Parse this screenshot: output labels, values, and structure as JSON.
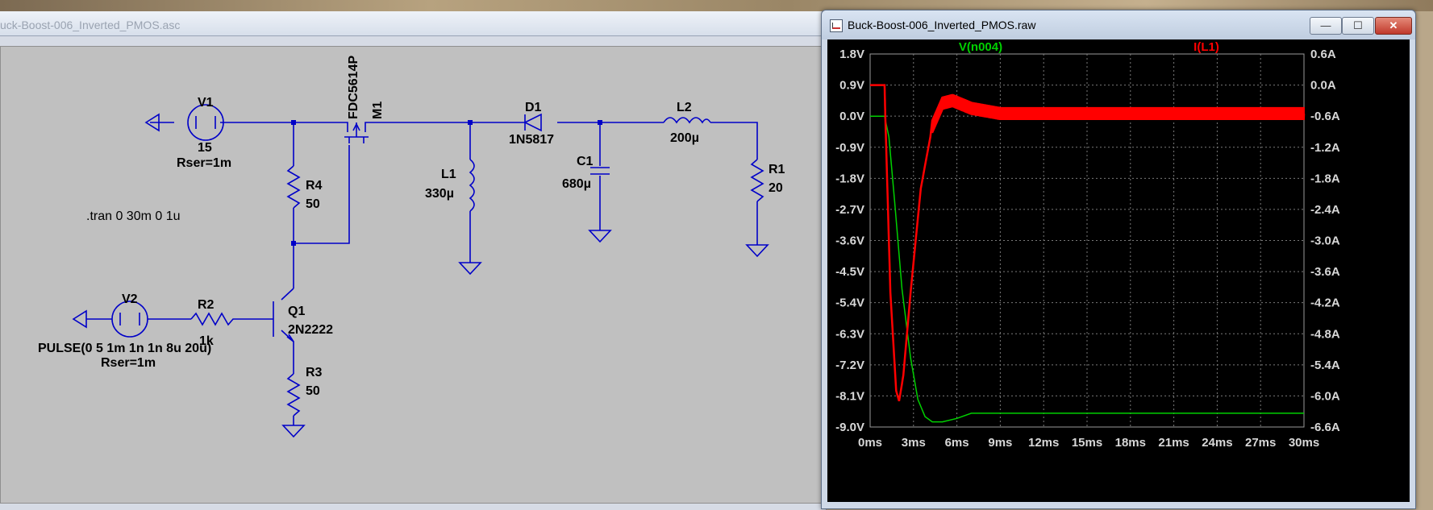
{
  "schematic_window": {
    "title": "uck-Boost-006_Inverted_PMOS.asc"
  },
  "schematic": {
    "directive": ".tran 0 30m 0 1u",
    "V1": {
      "name": "V1",
      "value": "15",
      "rser": "Rser=1m"
    },
    "V2": {
      "name": "V2",
      "value": "PULSE(0 5 1m 1n 1n 8u 20u)",
      "rser": "Rser=1m"
    },
    "R1": {
      "name": "R1",
      "value": "20"
    },
    "R2": {
      "name": "R2",
      "value": "1k"
    },
    "R3": {
      "name": "R3",
      "value": "50"
    },
    "R4": {
      "name": "R4",
      "value": "50"
    },
    "L1": {
      "name": "L1",
      "value": "330µ"
    },
    "L2": {
      "name": "L2",
      "value": "200µ"
    },
    "C1": {
      "name": "C1",
      "value": "680µ"
    },
    "D1": {
      "name": "D1",
      "value": "1N5817"
    },
    "M1": {
      "name": "M1",
      "value": "FDC5614P"
    },
    "Q1": {
      "name": "Q1",
      "value": "2N2222"
    }
  },
  "waveform_window": {
    "title": "Buck-Boost-006_Inverted_PMOS.raw",
    "buttons": {
      "minimize": "—",
      "maximize": "☐",
      "close": "✕"
    }
  },
  "chart_data": {
    "type": "line",
    "x_ticks": [
      "0ms",
      "3ms",
      "6ms",
      "9ms",
      "12ms",
      "15ms",
      "18ms",
      "21ms",
      "24ms",
      "27ms",
      "30ms"
    ],
    "xlim": [
      0,
      30
    ],
    "left_axis": {
      "ticks": [
        "1.8V",
        "0.9V",
        "0.0V",
        "-0.9V",
        "-1.8V",
        "-2.7V",
        "-3.6V",
        "-4.5V",
        "-5.4V",
        "-6.3V",
        "-7.2V",
        "-8.1V",
        "-9.0V"
      ],
      "ylim": [
        -9.0,
        1.8
      ]
    },
    "right_axis": {
      "ticks": [
        "0.6A",
        "0.0A",
        "-0.6A",
        "-1.2A",
        "-1.8A",
        "-2.4A",
        "-3.0A",
        "-3.6A",
        "-4.2A",
        "-4.8A",
        "-5.4A",
        "-6.0A",
        "-6.6A"
      ],
      "ylim": [
        -6.6,
        0.6
      ]
    },
    "grid": true,
    "series": [
      {
        "name": "V(n004)",
        "color": "#00d000",
        "axis": "left",
        "x": [
          0,
          1.0,
          1.3,
          1.7,
          2.2,
          2.8,
          3.3,
          3.8,
          4.3,
          5.0,
          6.0,
          7.0,
          9.0,
          30.0
        ],
        "y": [
          0.0,
          0.0,
          -0.6,
          -2.5,
          -5.0,
          -7.0,
          -8.2,
          -8.7,
          -8.85,
          -8.85,
          -8.75,
          -8.6,
          -8.6,
          -8.6
        ]
      },
      {
        "name": "I(L1)",
        "color": "#ff0000",
        "axis": "right",
        "x": [
          0,
          1.0,
          1.05,
          1.4,
          1.8,
          2.0,
          2.3,
          2.8,
          3.5,
          4.3,
          5.0,
          5.7,
          7.0,
          9.0,
          30.0
        ],
        "y": [
          0.0,
          0.0,
          -0.6,
          -4.0,
          -5.9,
          -6.1,
          -5.6,
          -4.0,
          -2.0,
          -0.8,
          -0.35,
          -0.3,
          -0.45,
          -0.55,
          -0.55
        ],
        "ripple": 0.25
      }
    ]
  }
}
